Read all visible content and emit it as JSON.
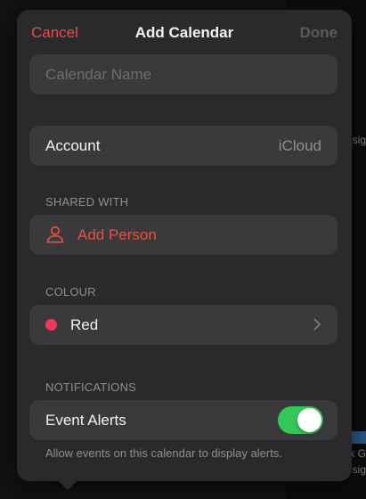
{
  "nav": {
    "cancel_label": "Cancel",
    "title": "Add Calendar",
    "done_label": "Done"
  },
  "calendar_name": {
    "value": "",
    "placeholder": "Calendar Name"
  },
  "account": {
    "label": "Account",
    "value": "iCloud"
  },
  "shared_with": {
    "header": "SHARED WITH",
    "add_person_label": "Add Person",
    "icon": "person-icon"
  },
  "colour": {
    "header": "COLOUR",
    "selected_label": "Red",
    "selected_color": "#f0365a"
  },
  "notifications": {
    "header": "NOTIFICATIONS",
    "event_alerts_label": "Event Alerts",
    "event_alerts_enabled": true,
    "footer": "Allow events on this calendar to display alerts."
  },
  "background": {
    "fragment_1": "sig",
    "fragment_2": "k G",
    "fragment_3": "sig"
  },
  "colors": {
    "accent": "#e5503f",
    "toggle_on": "#34c759",
    "sheet": "#2a2a2c",
    "cell": "#3a3a3c"
  }
}
